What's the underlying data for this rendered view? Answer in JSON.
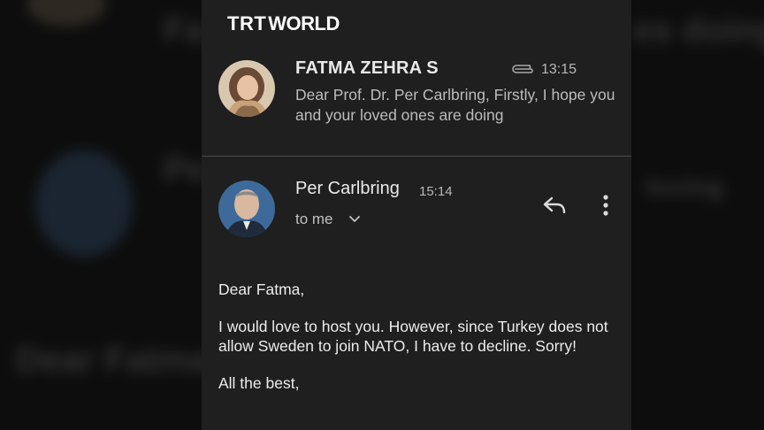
{
  "background": {
    "blur_words": [
      "Fa",
      "Pe",
      "Dear Fatma,",
      "es doing",
      "loving"
    ]
  },
  "brand": {
    "logo_part1": "TRT",
    "logo_part2": "WORLD"
  },
  "messages": [
    {
      "sender": "FATMA ZEHRA S",
      "time": "13:15",
      "has_attachment": true,
      "preview": "Dear Prof. Dr. Per Carlbring, Firstly, I hope you and your loved ones are doing"
    },
    {
      "sender": "Per Carlbring",
      "time": "15:14",
      "recipient_label": "to me",
      "body": {
        "greeting": "Dear Fatma,",
        "main": "I would love to host you. However, since Turkey does not allow Sweden to join NATO, I have to decline. Sorry!",
        "closing": "All the best,"
      }
    }
  ],
  "icons": {
    "attachment": "paperclip-icon",
    "expand": "chevron-down-icon",
    "reply": "reply-icon",
    "more": "more-vert-icon"
  },
  "colors": {
    "panel_bg": "#1f1f1f",
    "page_bg": "#101010",
    "text_primary": "#e9e9e9",
    "text_secondary": "#bcbcbc"
  }
}
